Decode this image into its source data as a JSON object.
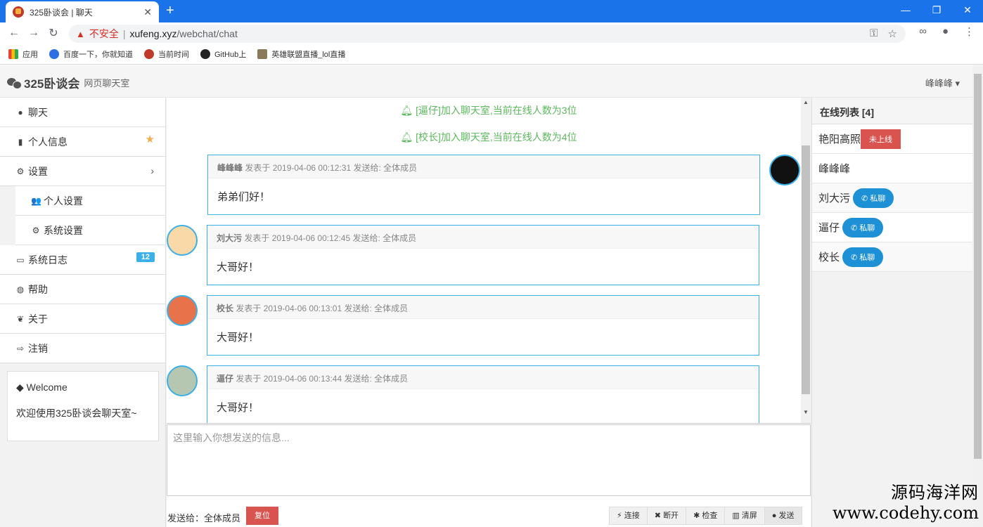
{
  "browser": {
    "tab_title": "325卧谈会 | 聊天",
    "new_tab": "+",
    "insecure_label": "不安全",
    "separator": "|",
    "url_host": "xufeng.xyz",
    "url_path": "/webchat/chat",
    "bookmarks": [
      "应用",
      "百度一下，你就知道",
      "当前时间",
      "GitHub上",
      "英雄联盟直播_lol直播"
    ]
  },
  "header": {
    "brand": "325卧谈会",
    "subtitle": "网页聊天室",
    "user": "峰峰峰 ▾"
  },
  "sidebar": {
    "items": [
      {
        "label": "聊天"
      },
      {
        "label": "个人信息"
      },
      {
        "label": "设置"
      },
      {
        "label": "个人设置"
      },
      {
        "label": "系统设置"
      },
      {
        "label": "系统日志",
        "badge": "12"
      },
      {
        "label": "帮助"
      },
      {
        "label": "关于"
      },
      {
        "label": "注销"
      }
    ],
    "welcome": {
      "title": "Welcome",
      "body": "欢迎使用325卧谈会聊天室~"
    }
  },
  "chat": {
    "notices": [
      "[逼仔]加入聊天室,当前在线人数为3位",
      "[校长]加入聊天室,当前在线人数为4位"
    ],
    "messages": [
      {
        "who": "峰峰峰",
        "meta": "发表于 2019-04-06 00:12:31 发送给: 全体成员",
        "text": "弟弟们好！"
      },
      {
        "who": "刘大污",
        "meta": "发表于 2019-04-06 00:12:45 发送给: 全体成员",
        "text": "大哥好！"
      },
      {
        "who": "校长",
        "meta": "发表于 2019-04-06 00:13:01 发送给: 全体成员",
        "text": "大哥好！"
      },
      {
        "who": "逼仔",
        "meta": "发表于 2019-04-06 00:13:44 发送给: 全体成员",
        "text": "大哥好！"
      }
    ],
    "input_placeholder": "这里输入你想发送的信息...",
    "send_to": "发送给：全体成员",
    "reset": "复位",
    "actions": [
      "连接",
      "断开",
      "检查",
      "清屏",
      "发送"
    ]
  },
  "online": {
    "title": "在线列表 [4]",
    "users": [
      {
        "name": "艳阳高照",
        "tag": "未上线"
      },
      {
        "name": "峰峰峰",
        "tag": ""
      },
      {
        "name": "刘大污",
        "tag": "私聊"
      },
      {
        "name": "逼仔",
        "tag": "私聊"
      },
      {
        "name": "校长",
        "tag": "私聊"
      }
    ]
  },
  "watermark": {
    "line1": "源码海洋网",
    "line2": "www.codehy.com"
  }
}
